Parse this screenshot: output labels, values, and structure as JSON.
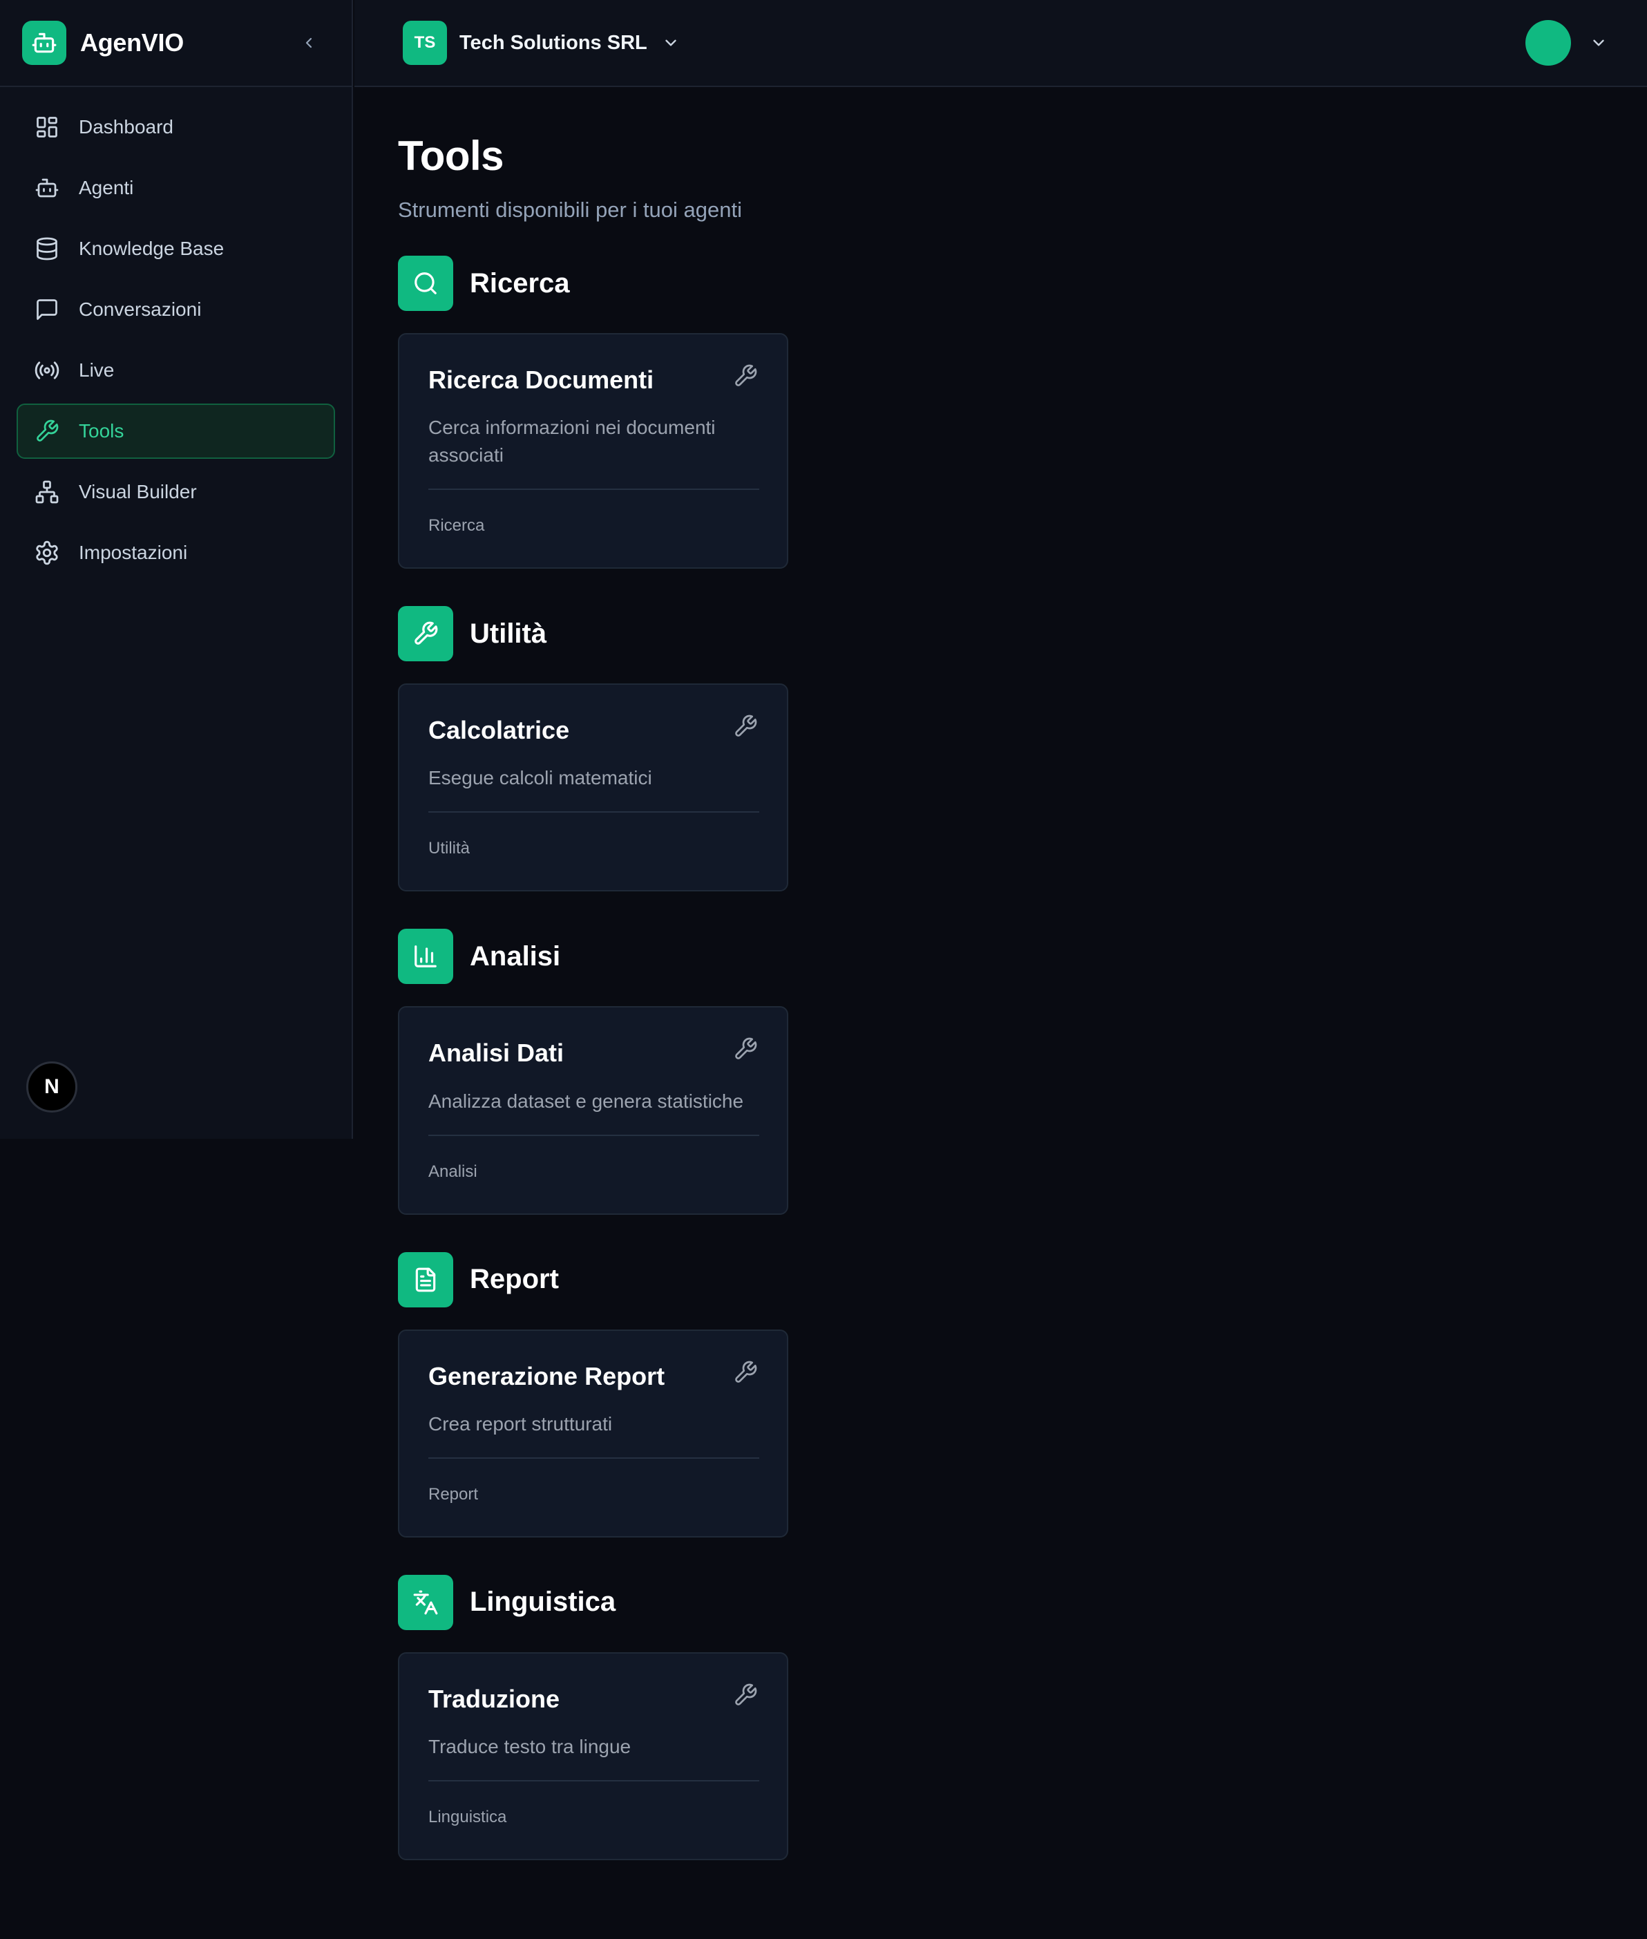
{
  "app": {
    "name": "AgenVIO",
    "accent_color": "#10b981",
    "logo_icon": "robot-icon"
  },
  "sidebar": {
    "items": [
      {
        "label": "Dashboard",
        "icon": "dashboard-icon",
        "active": false
      },
      {
        "label": "Agenti",
        "icon": "robot-icon",
        "active": false
      },
      {
        "label": "Knowledge Base",
        "icon": "database-icon",
        "active": false
      },
      {
        "label": "Conversazioni",
        "icon": "chat-icon",
        "active": false
      },
      {
        "label": "Live",
        "icon": "broadcast-icon",
        "active": false
      },
      {
        "label": "Tools",
        "icon": "wrench-icon",
        "active": true
      },
      {
        "label": "Visual Builder",
        "icon": "network-icon",
        "active": false
      },
      {
        "label": "Impostazioni",
        "icon": "gear-icon",
        "active": false
      }
    ],
    "footer_badge": "N"
  },
  "topbar": {
    "org_initials": "TS",
    "org_name": "Tech Solutions SRL"
  },
  "page": {
    "title": "Tools",
    "subtitle": "Strumenti disponibili per i tuoi agenti"
  },
  "sections": [
    {
      "title": "Ricerca",
      "icon": "search-icon",
      "card": {
        "title": "Ricerca Documenti",
        "description": "Cerca informazioni nei documenti associati",
        "category": "Ricerca"
      }
    },
    {
      "title": "Utilità",
      "icon": "wrench-icon",
      "card": {
        "title": "Calcolatrice",
        "description": "Esegue calcoli matematici",
        "category": "Utilità"
      }
    },
    {
      "title": "Analisi",
      "icon": "bar-chart-icon",
      "card": {
        "title": "Analisi Dati",
        "description": "Analizza dataset e genera statistiche",
        "category": "Analisi"
      }
    },
    {
      "title": "Report",
      "icon": "document-icon",
      "card": {
        "title": "Generazione Report",
        "description": "Crea report strutturati",
        "category": "Report"
      }
    },
    {
      "title": "Linguistica",
      "icon": "translate-icon",
      "card": {
        "title": "Traduzione",
        "description": "Traduce testo tra lingue",
        "category": "Linguistica"
      }
    }
  ]
}
